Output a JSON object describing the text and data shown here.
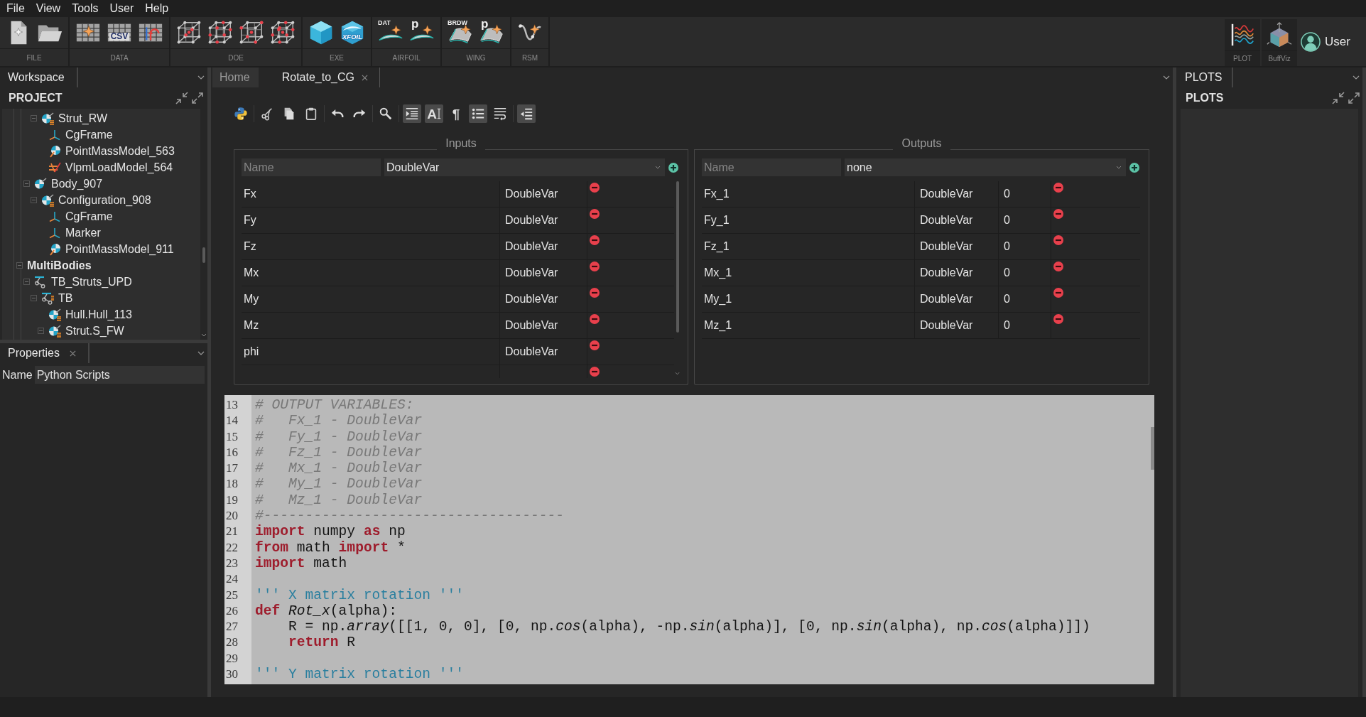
{
  "menu": [
    {
      "label": "File"
    },
    {
      "label": "View"
    },
    {
      "label": "Tools"
    },
    {
      "label": "User"
    },
    {
      "label": "Help"
    }
  ],
  "toolbar": {
    "groups": [
      {
        "label": "FILE",
        "buttons": [
          {
            "kind": "new-file"
          },
          {
            "kind": "open-folder"
          }
        ]
      },
      {
        "label": "DATA",
        "buttons": [
          {
            "kind": "data-grid"
          },
          {
            "kind": "csv",
            "text": "CSV"
          },
          {
            "kind": "data-import"
          }
        ]
      },
      {
        "label": "DOE",
        "buttons": [
          {
            "kind": "lattice-center"
          },
          {
            "kind": "lattice-face"
          },
          {
            "kind": "lattice-corner"
          },
          {
            "kind": "lattice-full"
          }
        ]
      },
      {
        "label": "EXE",
        "buttons": [
          {
            "kind": "cube"
          },
          {
            "kind": "xfoil",
            "text": "XFOIL"
          }
        ]
      },
      {
        "label": "AIRFOIL",
        "buttons": [
          {
            "kind": "airfoil",
            "text": "DAT"
          },
          {
            "kind": "airfoil",
            "text": "p"
          }
        ]
      },
      {
        "label": "WING",
        "buttons": [
          {
            "kind": "wing",
            "text": "BRDW"
          },
          {
            "kind": "wing",
            "text": "p"
          }
        ]
      },
      {
        "label": "RSM",
        "buttons": [
          {
            "kind": "rsm"
          }
        ]
      }
    ],
    "right_groups": [
      {
        "label": "PLOT",
        "buttons": [
          {
            "kind": "plot"
          }
        ]
      },
      {
        "label": "BuffViz",
        "buttons": [
          {
            "kind": "buffviz"
          }
        ]
      }
    ],
    "user": {
      "label": "User"
    }
  },
  "left_dock": {
    "tabs": [
      {
        "label": "Workspace",
        "selected": true,
        "closable": false
      }
    ],
    "title": "PROJECT",
    "tree": [
      {
        "children": [
          {
            "children": [
              {
                "label": "Strut_RW",
                "kind": "body-list",
                "expanded": true,
                "children": [
                  {
                    "label": "CgFrame",
                    "kind": "frame"
                  },
                  {
                    "label": "PointMassModel_563",
                    "kind": "point-mass"
                  },
                  {
                    "label": "VlpmLoadModel_564",
                    "kind": "load-model"
                  }
                ]
              }
            ]
          },
          {
            "label": "Body_907",
            "kind": "body",
            "expanded": true,
            "children": [
              {
                "label": "Configuration_908",
                "kind": "body-list",
                "expanded": true,
                "children": [
                  {
                    "label": "CgFrame",
                    "kind": "frame"
                  },
                  {
                    "label": "Marker",
                    "kind": "frame"
                  },
                  {
                    "label": "PointMassModel_911",
                    "kind": "point-mass"
                  }
                ]
              }
            ]
          }
        ]
      },
      {
        "label": "MultiBodies",
        "kind": "group",
        "expanded": true,
        "children": [
          {
            "label": "TB_Struts_UPD",
            "kind": "multibody",
            "expanded": true,
            "children": [
              {
                "label": "TB",
                "kind": "multibody-list",
                "expanded": true,
                "children": [
                  {
                    "label": "Hull.Hull_113",
                    "kind": "body-list"
                  },
                  {
                    "label": "Strut.S_FW",
                    "kind": "body-list",
                    "expanded": true
                  }
                ]
              }
            ]
          }
        ]
      }
    ]
  },
  "properties": {
    "tabs": [
      {
        "label": "Properties",
        "selected": true,
        "closable": true
      }
    ],
    "rows": [
      {
        "name": "Name",
        "value": "Python Scripts"
      }
    ]
  },
  "editor": {
    "tabs": [
      {
        "label": "Home",
        "selected": false,
        "closable": false
      },
      {
        "label": "Rotate_to_CG",
        "selected": true,
        "closable": true
      }
    ],
    "toolbar": [
      {
        "buttons": [
          {
            "kind": "python",
            "on": false
          }
        ]
      },
      {
        "buttons": [
          {
            "kind": "cut",
            "on": false
          },
          {
            "kind": "copy",
            "on": false
          },
          {
            "kind": "paste",
            "on": false
          }
        ]
      },
      {
        "buttons": [
          {
            "kind": "undo",
            "on": false
          },
          {
            "kind": "redo",
            "on": false
          }
        ]
      },
      {
        "buttons": [
          {
            "kind": "search",
            "on": false
          }
        ]
      },
      {
        "buttons": [
          {
            "kind": "indent",
            "on": true
          },
          {
            "kind": "font",
            "on": true,
            "text": "A"
          },
          {
            "kind": "pilcrow",
            "on": false,
            "text": "¶"
          },
          {
            "kind": "bullets",
            "on": true
          },
          {
            "kind": "wrap",
            "on": false
          }
        ]
      },
      {
        "buttons": [
          {
            "kind": "outdent",
            "on": true
          }
        ]
      }
    ],
    "inputs": {
      "title": "Inputs",
      "name_placeholder": "Name",
      "type_value": "DoubleVar",
      "rows": [
        {
          "kind": "variable",
          "name": "Fx",
          "type": "DoubleVar"
        },
        {
          "kind": "variable",
          "name": "Fy",
          "type": "DoubleVar"
        },
        {
          "kind": "variable",
          "name": "Fz",
          "type": "DoubleVar"
        },
        {
          "kind": "variable",
          "name": "Mx",
          "type": "DoubleVar"
        },
        {
          "kind": "variable",
          "name": "My",
          "type": "DoubleVar"
        },
        {
          "kind": "variable",
          "name": "Mz",
          "type": "DoubleVar"
        },
        {
          "kind": "variable",
          "name": "phi",
          "type": "DoubleVar"
        },
        {
          "kind": "clipped"
        }
      ]
    },
    "outputs": {
      "title": "Outputs",
      "name_placeholder": "Name",
      "type_value": "none",
      "rows": [
        {
          "name": "Fx_1",
          "type": "DoubleVar",
          "value": "0"
        },
        {
          "name": "Fy_1",
          "type": "DoubleVar",
          "value": "0"
        },
        {
          "name": "Fz_1",
          "type": "DoubleVar",
          "value": "0"
        },
        {
          "name": "Mx_1",
          "type": "DoubleVar",
          "value": "0"
        },
        {
          "name": "My_1",
          "type": "DoubleVar",
          "value": "0"
        },
        {
          "name": "Mz_1",
          "type": "DoubleVar",
          "value": "0"
        }
      ]
    },
    "code": {
      "lines": [
        {
          "number": "13",
          "tokens": [
            {
              "kind": "comment",
              "text": "# OUTPUT VARIABLES:"
            }
          ]
        },
        {
          "number": "14",
          "tokens": [
            {
              "kind": "comment",
              "text": "#   Fx_1 - DoubleVar"
            }
          ]
        },
        {
          "number": "15",
          "tokens": [
            {
              "kind": "comment",
              "text": "#   Fy_1 - DoubleVar"
            }
          ]
        },
        {
          "number": "16",
          "tokens": [
            {
              "kind": "comment",
              "text": "#   Fz_1 - DoubleVar"
            }
          ]
        },
        {
          "number": "17",
          "tokens": [
            {
              "kind": "comment",
              "text": "#   Mx_1 - DoubleVar"
            }
          ]
        },
        {
          "number": "18",
          "tokens": [
            {
              "kind": "comment",
              "text": "#   My_1 - DoubleVar"
            }
          ]
        },
        {
          "number": "19",
          "tokens": [
            {
              "kind": "comment",
              "text": "#   Mz_1 - DoubleVar"
            }
          ]
        },
        {
          "number": "20",
          "tokens": [
            {
              "kind": "comment",
              "text": "#------------------------------------"
            }
          ]
        },
        {
          "number": "21",
          "tokens": [
            {
              "kind": "keyword",
              "text": "import"
            },
            {
              "kind": "plain",
              "text": " numpy "
            },
            {
              "kind": "keyword",
              "text": "as"
            },
            {
              "kind": "plain",
              "text": " np"
            }
          ]
        },
        {
          "number": "22",
          "tokens": [
            {
              "kind": "keyword",
              "text": "from"
            },
            {
              "kind": "plain",
              "text": " math "
            },
            {
              "kind": "keyword",
              "text": "import"
            },
            {
              "kind": "plain",
              "text": " *"
            }
          ]
        },
        {
          "number": "23",
          "tokens": [
            {
              "kind": "keyword",
              "text": "import"
            },
            {
              "kind": "plain",
              "text": " math"
            }
          ]
        },
        {
          "number": "24"
        },
        {
          "number": "25",
          "tokens": [
            {
              "kind": "docstring",
              "text": "''' X matrix rotation '''"
            }
          ]
        },
        {
          "number": "26",
          "tokens": [
            {
              "kind": "keyword",
              "text": "def "
            },
            {
              "kind": "function",
              "text": "Rot_x"
            },
            {
              "kind": "plain",
              "text": "(alpha):"
            }
          ]
        },
        {
          "number": "27",
          "tokens": [
            {
              "kind": "plain",
              "text": "    R = np."
            },
            {
              "kind": "function",
              "text": "array"
            },
            {
              "kind": "plain",
              "text": "([[1, 0, 0], [0, np."
            },
            {
              "kind": "function",
              "text": "cos"
            },
            {
              "kind": "plain",
              "text": "(alpha), -np."
            },
            {
              "kind": "function",
              "text": "sin"
            },
            {
              "kind": "plain",
              "text": "(alpha)], [0, np."
            },
            {
              "kind": "function",
              "text": "sin"
            },
            {
              "kind": "plain",
              "text": "(alpha), np."
            },
            {
              "kind": "function",
              "text": "cos"
            },
            {
              "kind": "plain",
              "text": "(alpha)]])"
            }
          ]
        },
        {
          "number": "28",
          "tokens": [
            {
              "kind": "keyword",
              "text": "    return"
            },
            {
              "kind": "plain",
              "text": " R"
            }
          ]
        },
        {
          "number": "29"
        },
        {
          "number": "30",
          "tokens": [
            {
              "kind": "docstring",
              "text": "''' Y matrix rotation '''"
            }
          ]
        }
      ]
    }
  },
  "right_dock": {
    "tabs": [
      {
        "label": "PLOTS",
        "selected": true,
        "closable": false
      }
    ],
    "title": "PLOTS"
  }
}
